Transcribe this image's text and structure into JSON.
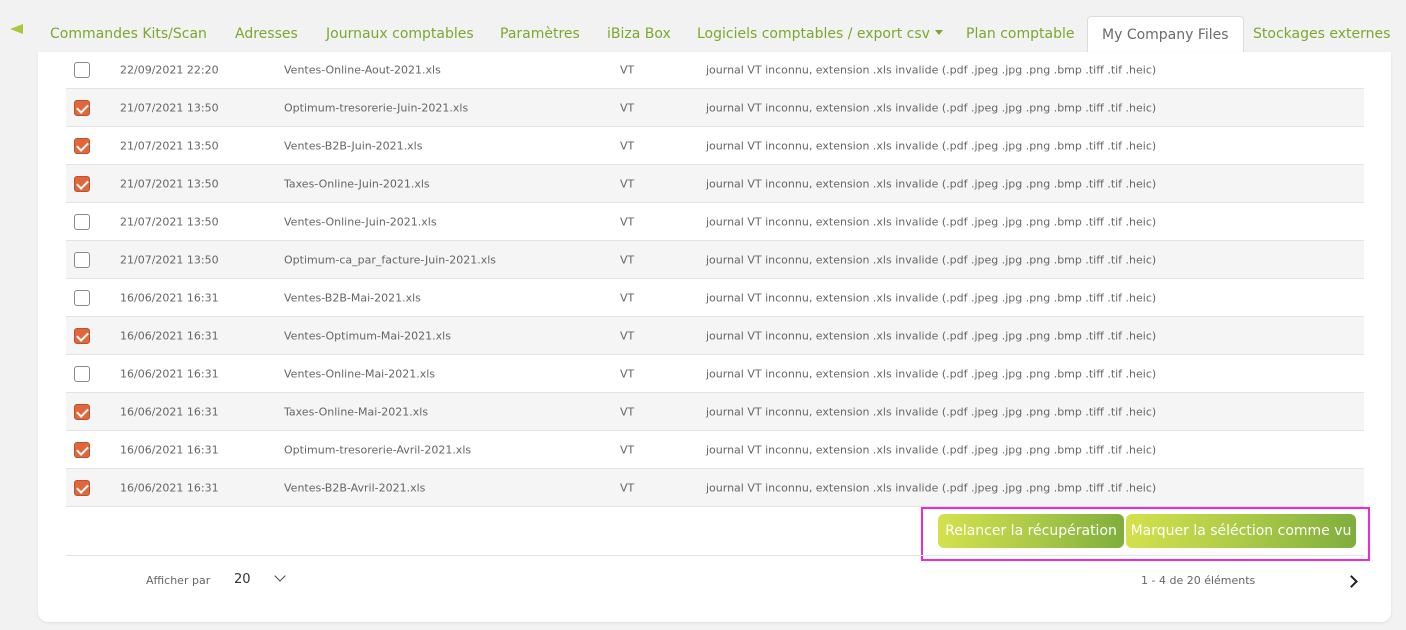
{
  "tabs": [
    {
      "label": "Commandes Kits/Scan"
    },
    {
      "label": "Adresses"
    },
    {
      "label": "Journaux comptables"
    },
    {
      "label": "Paramètres"
    },
    {
      "label": "iBiza Box"
    },
    {
      "label": "Logiciels comptables / export csv"
    },
    {
      "label": "Plan comptable"
    },
    {
      "label": "My Company Files",
      "active": true
    },
    {
      "label": "Stockages externes"
    }
  ],
  "rows": [
    {
      "checked": false,
      "date": "22/09/2021 22:20",
      "file": "Ventes-Online-Aout-2021.xls",
      "journal": "VT",
      "error": "journal VT inconnu, extension .xls invalide (.pdf .jpeg .jpg .png .bmp .tiff .tif .heic)"
    },
    {
      "checked": true,
      "date": "21/07/2021 13:50",
      "file": "Optimum-tresorerie-Juin-2021.xls",
      "journal": "VT",
      "error": "journal VT inconnu, extension .xls invalide (.pdf .jpeg .jpg .png .bmp .tiff .tif .heic)"
    },
    {
      "checked": true,
      "date": "21/07/2021 13:50",
      "file": "Ventes-B2B-Juin-2021.xls",
      "journal": "VT",
      "error": "journal VT inconnu, extension .xls invalide (.pdf .jpeg .jpg .png .bmp .tiff .tif .heic)"
    },
    {
      "checked": true,
      "date": "21/07/2021 13:50",
      "file": "Taxes-Online-Juin-2021.xls",
      "journal": "VT",
      "error": "journal VT inconnu, extension .xls invalide (.pdf .jpeg .jpg .png .bmp .tiff .tif .heic)"
    },
    {
      "checked": false,
      "date": "21/07/2021 13:50",
      "file": "Ventes-Online-Juin-2021.xls",
      "journal": "VT",
      "error": "journal VT inconnu, extension .xls invalide (.pdf .jpeg .jpg .png .bmp .tiff .tif .heic)"
    },
    {
      "checked": false,
      "date": "21/07/2021 13:50",
      "file": "Optimum-ca_par_facture-Juin-2021.xls",
      "journal": "VT",
      "error": "journal VT inconnu, extension .xls invalide (.pdf .jpeg .jpg .png .bmp .tiff .tif .heic)"
    },
    {
      "checked": false,
      "date": "16/06/2021 16:31",
      "file": "Ventes-B2B-Mai-2021.xls",
      "journal": "VT",
      "error": "journal VT inconnu, extension .xls invalide (.pdf .jpeg .jpg .png .bmp .tiff .tif .heic)"
    },
    {
      "checked": true,
      "date": "16/06/2021 16:31",
      "file": "Ventes-Optimum-Mai-2021.xls",
      "journal": "VT",
      "error": "journal VT inconnu, extension .xls invalide (.pdf .jpeg .jpg .png .bmp .tiff .tif .heic)"
    },
    {
      "checked": false,
      "date": "16/06/2021 16:31",
      "file": "Ventes-Online-Mai-2021.xls",
      "journal": "VT",
      "error": "journal VT inconnu, extension .xls invalide (.pdf .jpeg .jpg .png .bmp .tiff .tif .heic)"
    },
    {
      "checked": true,
      "date": "16/06/2021 16:31",
      "file": "Taxes-Online-Mai-2021.xls",
      "journal": "VT",
      "error": "journal VT inconnu, extension .xls invalide (.pdf .jpeg .jpg .png .bmp .tiff .tif .heic)"
    },
    {
      "checked": true,
      "date": "16/06/2021 16:31",
      "file": "Optimum-tresorerie-Avril-2021.xls",
      "journal": "VT",
      "error": "journal VT inconnu, extension .xls invalide (.pdf .jpeg .jpg .png .bmp .tiff .tif .heic)"
    },
    {
      "checked": true,
      "date": "16/06/2021 16:31",
      "file": "Ventes-B2B-Avril-2021.xls",
      "journal": "VT",
      "error": "journal VT inconnu, extension .xls invalide (.pdf .jpeg .jpg .png .bmp .tiff .tif .heic)"
    }
  ],
  "actions": {
    "retry_label": "Relancer la récupération",
    "mark_seen_label": "Marquer la séléction comme vu"
  },
  "pagination": {
    "per_page_label": "Afficher par",
    "per_page_value": "20",
    "range_text": "1 - 4 de 20 éléments"
  },
  "colors": {
    "accent_green": "#7aa82d",
    "checkbox_checked": "#e2663a",
    "highlight_frame": "#e82cd6"
  }
}
